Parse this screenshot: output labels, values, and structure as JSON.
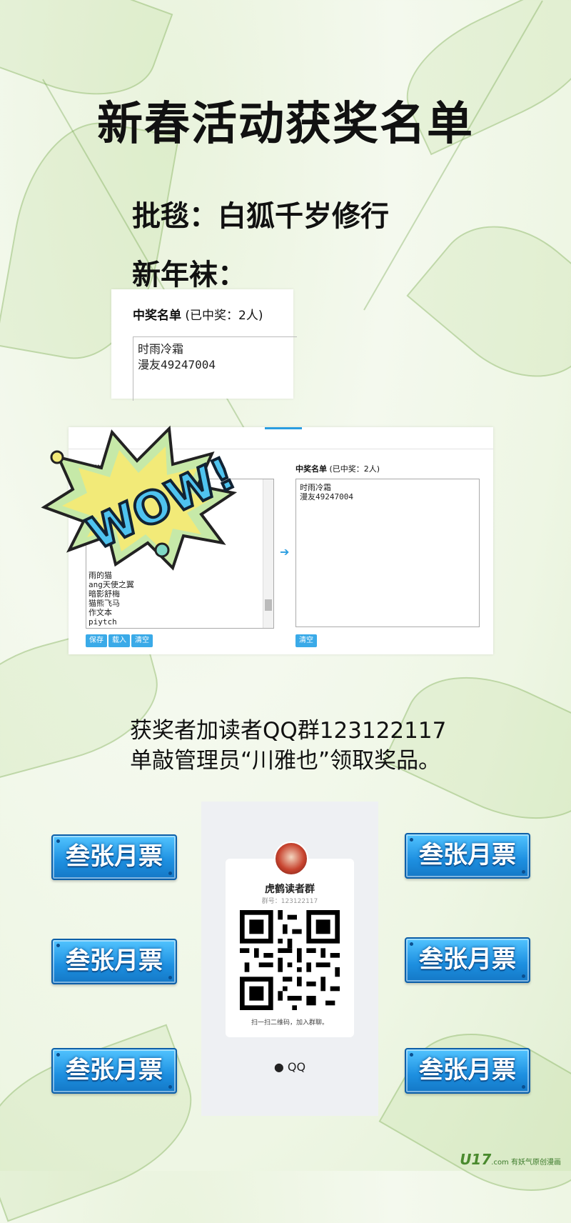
{
  "title": "新春活动获奖名单",
  "prizes": {
    "blanket": "批毯：白狐千岁修行",
    "newyear": "新年袜："
  },
  "winner_card": {
    "header_bold": "中奖名单",
    "header_rest": " (已中奖：2人)",
    "winners": [
      "时雨冷霜",
      "漫友49247004"
    ]
  },
  "lottery_panel": {
    "left_label": "抽奖",
    "left_list": [
      "雨的猫",
      "ang天使之翼",
      "暗影舒梅",
      "猫熊飞马",
      "作文本",
      "piytch"
    ],
    "right_label_bold": "中奖名单",
    "right_label_rest": " (已中奖：2人)",
    "right_list": [
      "时雨冷霜",
      "漫友49247004"
    ],
    "buttons": [
      "保存",
      "载入",
      "清空"
    ],
    "clear_right": "清空",
    "arrow": "➔",
    "sticker": "WOW!"
  },
  "notice": {
    "line1": "获奖者加读者QQ群123122117",
    "line2": "单敲管理员“川雅也”领取奖品。"
  },
  "qr_card": {
    "group_name": "虎鹤读者群",
    "group_number": "群号：123122117",
    "hint": "扫一扫二维码，加入群聊。",
    "footer": "QQ"
  },
  "tickets": [
    "叁张月票",
    "叁张月票",
    "叁张月票",
    "叁张月票",
    "叁张月票",
    "叁张月票"
  ],
  "watermark": {
    "brand": "U17",
    "sub": ".com",
    "slogan": "有妖气原创漫画"
  }
}
